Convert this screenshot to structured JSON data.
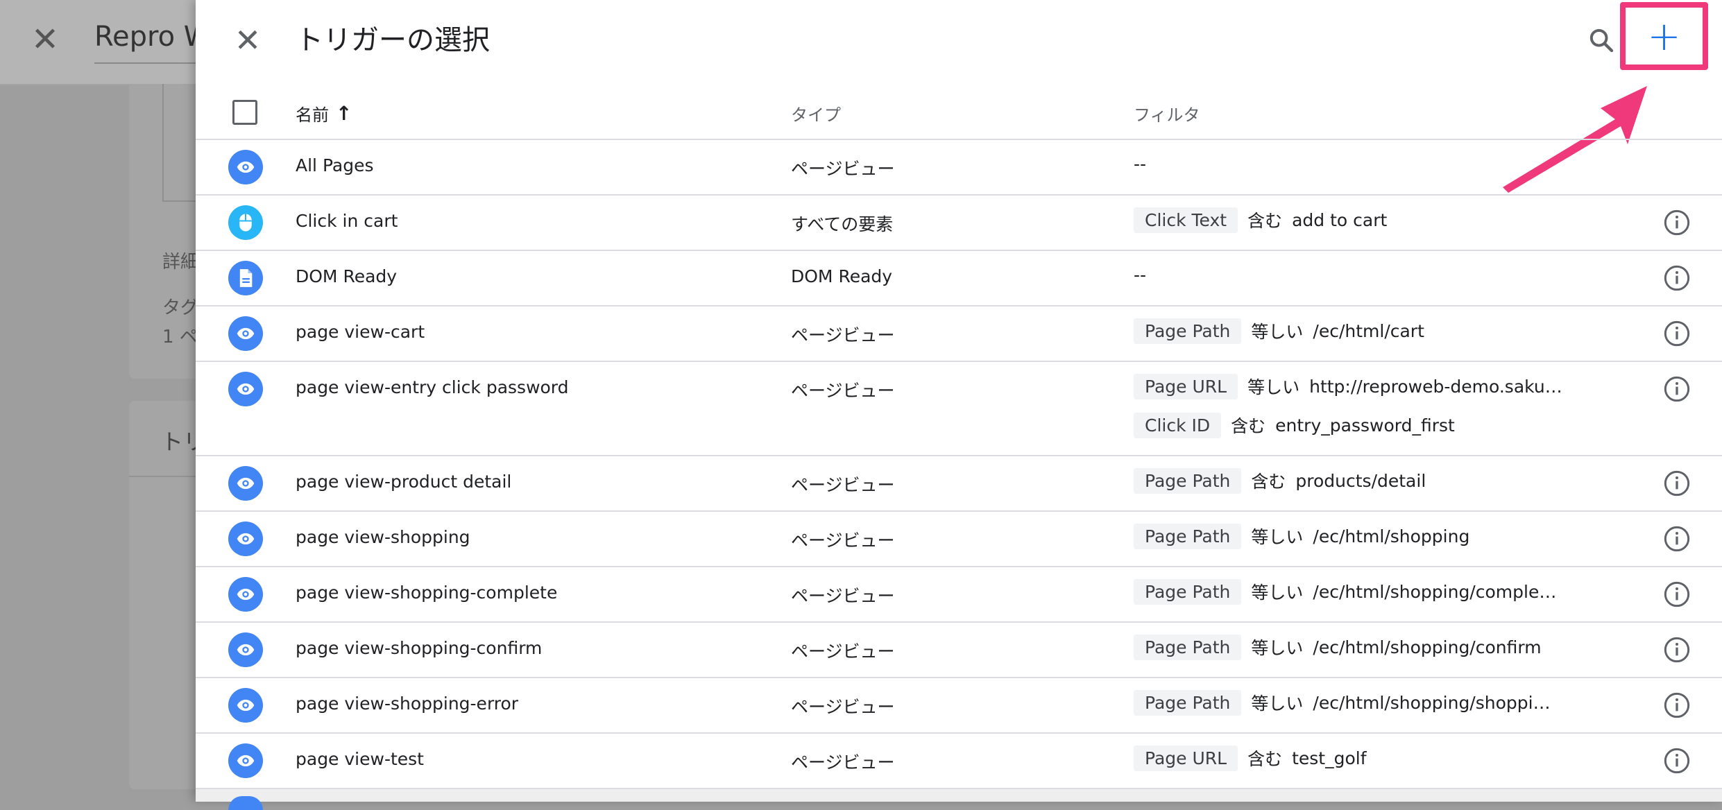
{
  "background": {
    "close_glyph": "✕",
    "title": "Repro W",
    "text1": "詳細",
    "text2": "タグ",
    "text3": "1 ペ",
    "text4": "トリ"
  },
  "panel": {
    "close_glyph": "✕",
    "title": "トリガーの選択",
    "add_glyph": "+"
  },
  "table": {
    "headers": {
      "name": "名前",
      "sort_glyph": "↑",
      "type": "タイプ",
      "filter": "フィルタ"
    },
    "rows": [
      {
        "icon": "eye-icon",
        "name": "All Pages",
        "type": "ページビュー",
        "filters": [],
        "empty": "--"
      },
      {
        "icon": "mouse-icon",
        "name": "Click in cart",
        "type": "すべての要素",
        "filters": [
          {
            "var": "Click Text",
            "op": "含む",
            "value": "add to cart"
          }
        ]
      },
      {
        "icon": "document-icon",
        "name": "DOM Ready",
        "type": "DOM Ready",
        "filters": [],
        "empty": "--"
      },
      {
        "icon": "eye-icon",
        "name": "page view-cart",
        "type": "ページビュー",
        "filters": [
          {
            "var": "Page Path",
            "op": "等しい",
            "value": "/ec/html/cart"
          }
        ]
      },
      {
        "icon": "eye-icon",
        "name": "page view-entry click password",
        "type": "ページビュー",
        "filters": [
          {
            "var": "Page URL",
            "op": "等しい",
            "value": "http://reproweb-demo.sakur…"
          },
          {
            "var": "Click ID",
            "op": "含む",
            "value": "entry_password_first"
          }
        ]
      },
      {
        "icon": "eye-icon",
        "name": "page view-product detail",
        "type": "ページビュー",
        "filters": [
          {
            "var": "Page Path",
            "op": "含む",
            "value": "products/detail"
          }
        ]
      },
      {
        "icon": "eye-icon",
        "name": "page view-shopping",
        "type": "ページビュー",
        "filters": [
          {
            "var": "Page Path",
            "op": "等しい",
            "value": "/ec/html/shopping"
          }
        ]
      },
      {
        "icon": "eye-icon",
        "name": "page view-shopping-complete",
        "type": "ページビュー",
        "filters": [
          {
            "var": "Page Path",
            "op": "等しい",
            "value": "/ec/html/shopping/comple…"
          }
        ]
      },
      {
        "icon": "eye-icon",
        "name": "page view-shopping-confirm",
        "type": "ページビュー",
        "filters": [
          {
            "var": "Page Path",
            "op": "等しい",
            "value": "/ec/html/shopping/confirm"
          }
        ]
      },
      {
        "icon": "eye-icon",
        "name": "page view-shopping-error",
        "type": "ページビュー",
        "filters": [
          {
            "var": "Page Path",
            "op": "等しい",
            "value": "/ec/html/shopping/shoppi…"
          }
        ]
      },
      {
        "icon": "eye-icon",
        "name": "page view-test",
        "type": "ページビュー",
        "filters": [
          {
            "var": "Page URL",
            "op": "含む",
            "value": "test_golf"
          }
        ]
      }
    ]
  },
  "colors": {
    "accent": "#1a73e8",
    "trigger_icon": "#4285f4",
    "click_icon": "#29b6f6",
    "highlight": "#f0397a"
  }
}
